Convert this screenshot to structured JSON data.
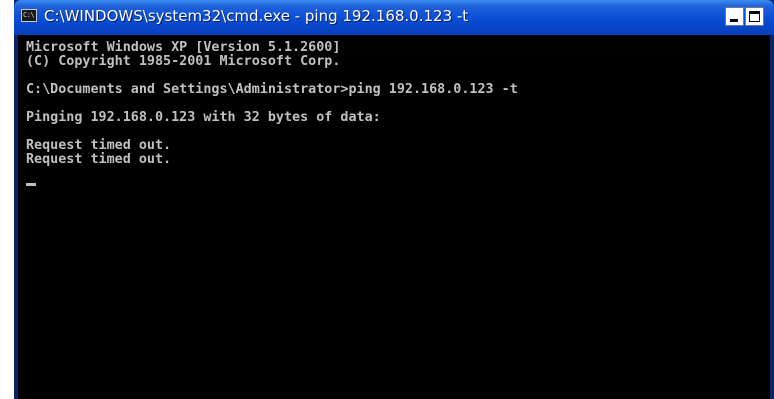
{
  "window": {
    "title": "C:\\WINDOWS\\system32\\cmd.exe - ping 192.168.0.123 -t",
    "icon": "console-app-icon",
    "icon_text": "C:\\"
  },
  "controls": {
    "minimize": "minimize-icon",
    "maximize": "maximize-icon"
  },
  "console": {
    "lines": [
      "Microsoft Windows XP [Version 5.1.2600]",
      "(C) Copyright 1985-2001 Microsoft Corp.",
      "C:\\Documents and Settings\\Administrator>ping 192.168.0.123 -t",
      "Pinging 192.168.0.123 with 32 bytes of data:",
      "Request timed out.",
      "Request timed out."
    ]
  },
  "colors": {
    "console_background": "#000000",
    "console_text": "#c0c0c0",
    "title_bar": "#0a4fd6"
  }
}
